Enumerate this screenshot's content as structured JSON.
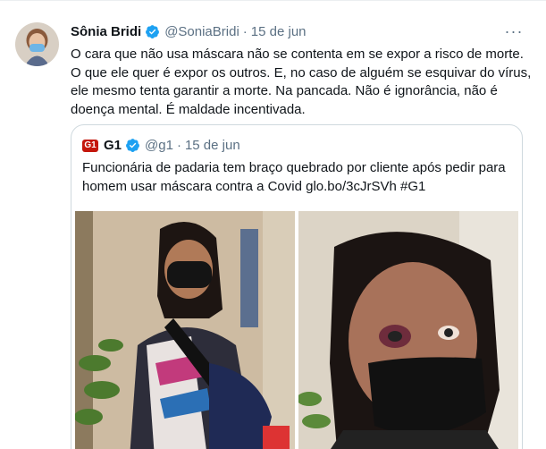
{
  "tweet": {
    "author_name": "Sônia Bridi",
    "author_handle": "@SoniaBridi",
    "separator": "·",
    "date": "15 de jun",
    "more_label": "···",
    "text_lines": [
      "O cara que não usa máscara não se contenta em se expor a risco de morte.",
      "O que ele quer é expor os outros. E, no caso de alguém se esquivar do vírus,",
      "ele mesmo tenta garantir a morte. Na pancada. Não é ignorância, não é",
      "doença mental. É maldade incentivada."
    ]
  },
  "quote": {
    "logo_text": "G1",
    "author_name": "G1",
    "author_handle": "@g1",
    "separator": "·",
    "date": "15 de jun",
    "text_lines": [
      "Funcionária de padaria tem braço quebrado por cliente após pedir para",
      "homem usar máscara contra a Covid glo.bo/3cJrSVh #G1"
    ]
  },
  "colors": {
    "verified": "#1da1f2",
    "secondary_text": "#5b7083",
    "g1_red": "#c4170c",
    "border": "#cfd9de"
  }
}
